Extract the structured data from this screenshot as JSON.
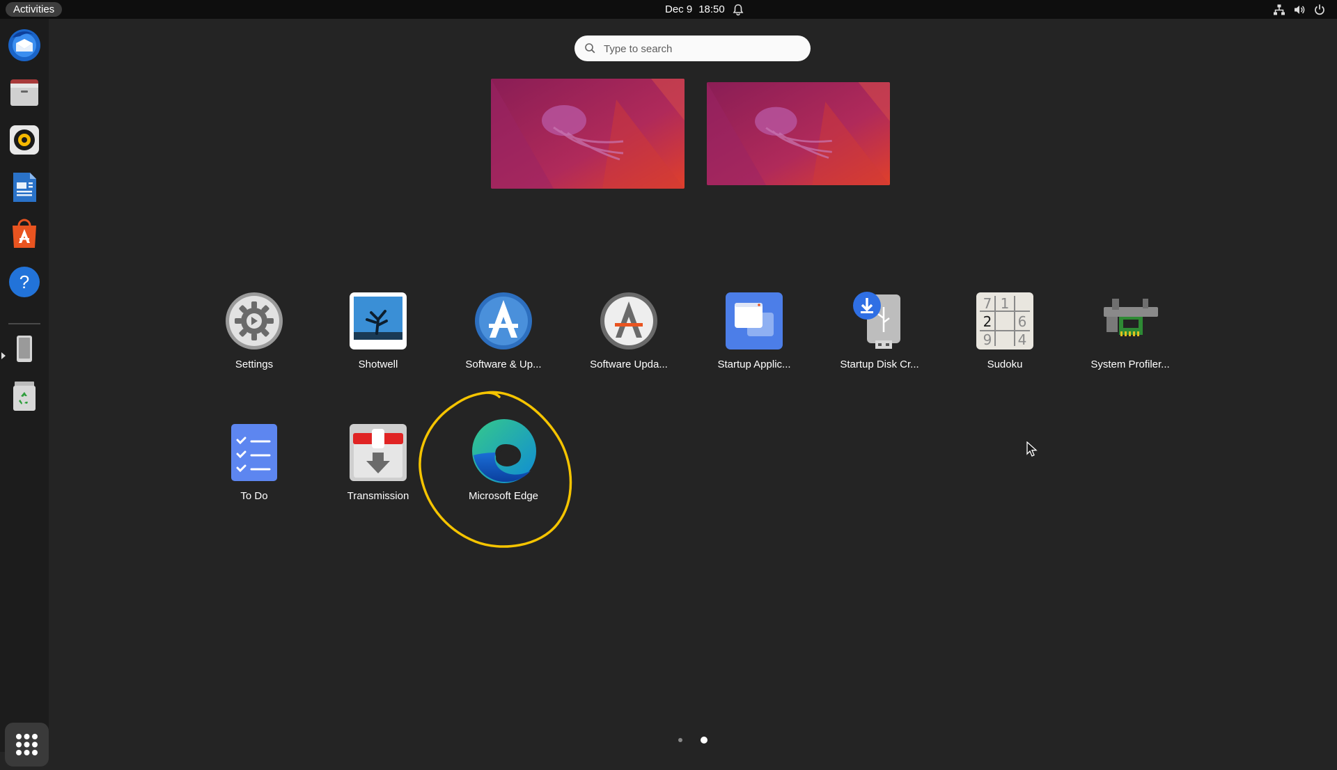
{
  "topbar": {
    "activities_label": "Activities",
    "date": "Dec 9",
    "time": "18:50",
    "icons": [
      "notification-bell-icon",
      "network-icon",
      "volume-icon",
      "power-icon"
    ]
  },
  "dock": {
    "items": [
      {
        "name": "Thunderbird Mail",
        "icon": "thunderbird-icon"
      },
      {
        "name": "Files",
        "icon": "files-icon"
      },
      {
        "name": "Rhythmbox",
        "icon": "rhythmbox-icon"
      },
      {
        "name": "LibreOffice Writer",
        "icon": "writer-icon"
      },
      {
        "name": "Ubuntu Software",
        "icon": "ubuntu-software-icon"
      },
      {
        "name": "Help",
        "icon": "help-icon"
      },
      {
        "name": "Removable Drive",
        "icon": "drive-icon"
      },
      {
        "name": "Trash",
        "icon": "trash-icon"
      }
    ],
    "show_apps_icon": "app-grid-icon"
  },
  "search": {
    "placeholder": "Type to search",
    "value": ""
  },
  "apps": [
    {
      "label": "Settings",
      "icon": "settings-icon"
    },
    {
      "label": "Shotwell",
      "icon": "shotwell-icon"
    },
    {
      "label": "Software & Up...",
      "icon": "software-updates-icon"
    },
    {
      "label": "Software Upda...",
      "icon": "software-updater-icon"
    },
    {
      "label": "Startup Applic...",
      "icon": "startup-applications-icon"
    },
    {
      "label": "Startup Disk Cr...",
      "icon": "startup-disk-creator-icon"
    },
    {
      "label": "Sudoku",
      "icon": "sudoku-icon"
    },
    {
      "label": "System Profiler...",
      "icon": "system-profiler-icon"
    },
    {
      "label": "To Do",
      "icon": "todo-icon"
    },
    {
      "label": "Transmission",
      "icon": "transmission-icon"
    },
    {
      "label": "Microsoft Edge",
      "icon": "microsoft-edge-icon"
    }
  ],
  "sudoku_digits": [
    "7",
    "1",
    "2",
    "6",
    "9",
    "4"
  ],
  "pagination": {
    "pages": 2,
    "current": 2
  },
  "colors": {
    "annotation": "#f5c400",
    "ubuntu_orange": "#e95420",
    "dock_bg": "#1c1c1c",
    "overview_bg": "#242424"
  }
}
